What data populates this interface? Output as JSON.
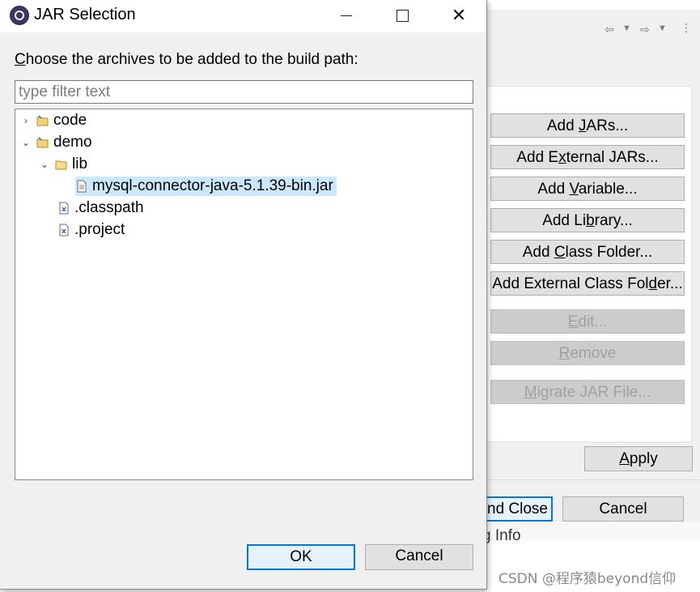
{
  "dialog": {
    "title": "JAR Selection",
    "prompt_label": "Choose the archives to be added to the build path:",
    "filter_placeholder": "type filter text",
    "ok_label": "OK",
    "cancel_label": "Cancel",
    "tree": [
      {
        "label": "code",
        "icon": "project-icon",
        "expanded": false
      },
      {
        "label": "demo",
        "icon": "project-icon",
        "expanded": true
      },
      {
        "label": "lib",
        "icon": "folder-icon",
        "expanded": true
      },
      {
        "label": "mysql-connector-java-5.1.39-bin.jar",
        "icon": "jar-file-icon",
        "selected": true
      },
      {
        "label": ".classpath",
        "icon": "xml-file-icon"
      },
      {
        "label": ".project",
        "icon": "xml-file-icon"
      }
    ]
  },
  "background_window": {
    "buttons": [
      {
        "pre": "Add ",
        "u": "J",
        "post": "ARs...",
        "enabled": true
      },
      {
        "pre": "Add E",
        "u": "x",
        "post": "ternal JARs...",
        "enabled": true
      },
      {
        "pre": "Add ",
        "u": "V",
        "post": "ariable...",
        "enabled": true
      },
      {
        "pre": "Add Li",
        "u": "b",
        "post": "rary...",
        "enabled": true
      },
      {
        "pre": "Add ",
        "u": "C",
        "post": "lass Folder...",
        "enabled": true
      },
      {
        "pre": "Add External Class Fol",
        "u": "d",
        "post": "er...",
        "enabled": true
      },
      {
        "pre": "",
        "u": "E",
        "post": "dit...",
        "enabled": false
      },
      {
        "pre": "",
        "u": "R",
        "post": "emove",
        "enabled": false
      },
      {
        "pre": "",
        "u": "M",
        "post": "igrate JAR File...",
        "enabled": false
      }
    ],
    "apply_pre": "",
    "apply_u": "A",
    "apply_post": "pply",
    "apply_close_label": "nd Close",
    "cancel_label": "Cancel",
    "info_fragment": "g Info"
  },
  "watermark": "CSDN @程序猿beyond信仰",
  "colors": {
    "selection": "#cce8ff",
    "focus_border": "#0078d7",
    "dialog_bg": "#f0f0f0"
  }
}
